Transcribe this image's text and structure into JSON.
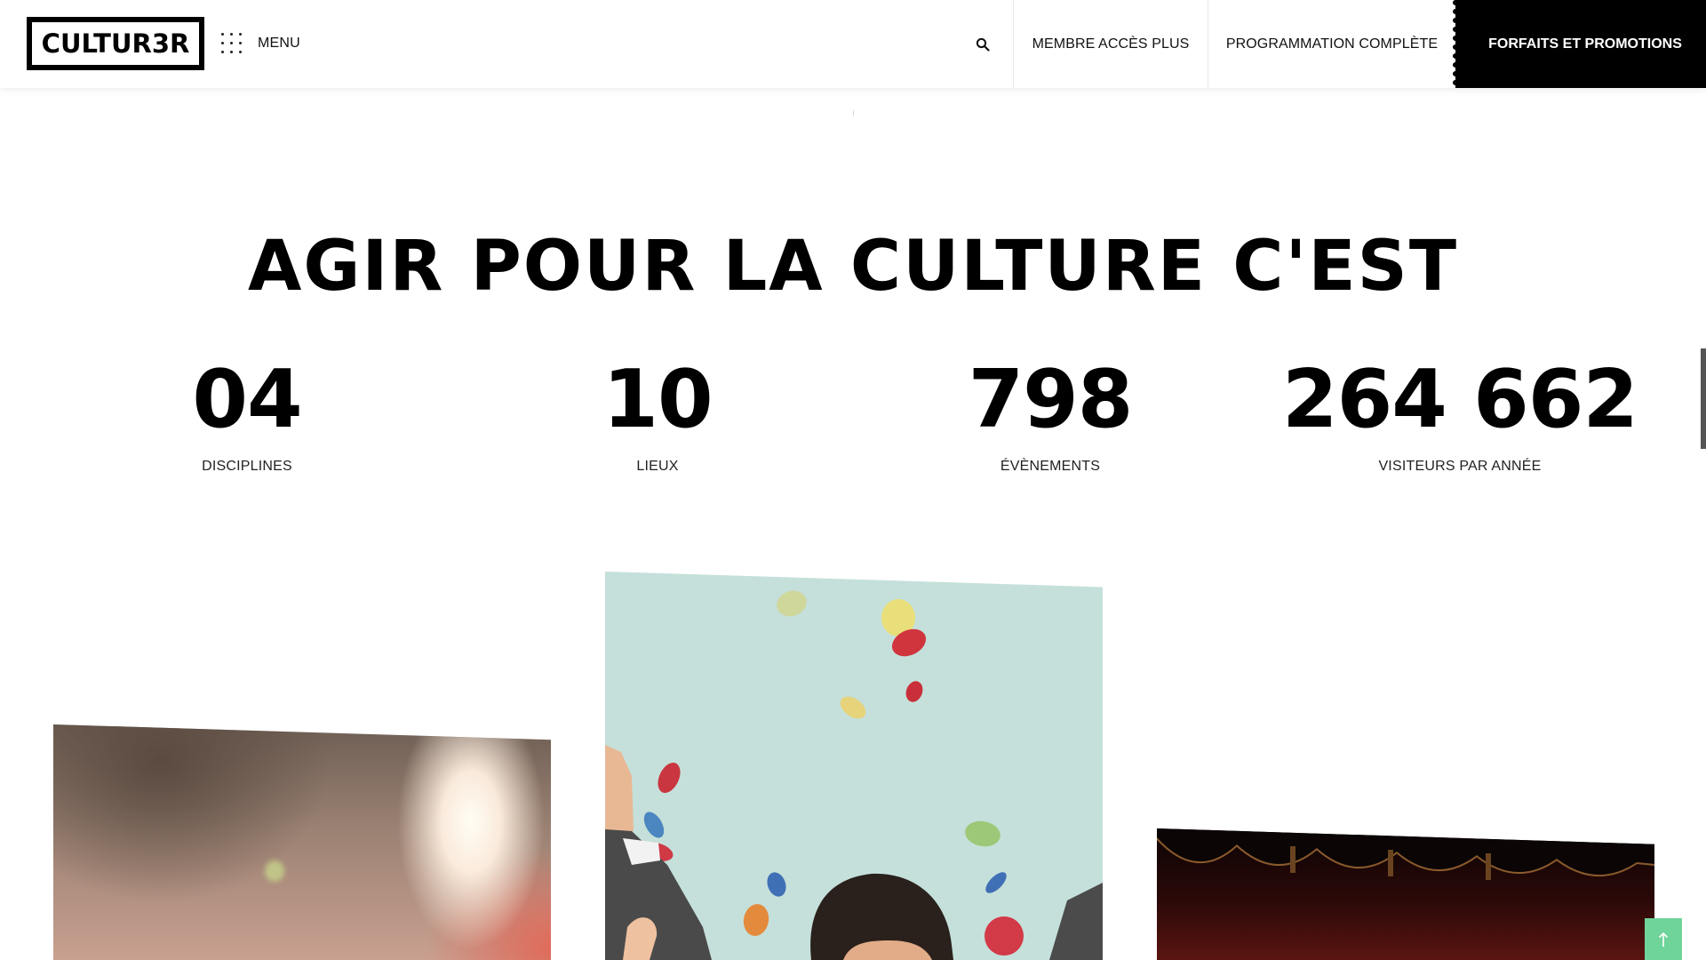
{
  "header": {
    "logo_text": "CULTUR3R",
    "menu_label": "MENU",
    "nav": {
      "membre": "MEMBRE ACCÈS PLUS",
      "programmation": "PROGRAMMATION COMPLÈTE",
      "forfaits": "FORFAITS ET PROMOTIONS"
    }
  },
  "main": {
    "headline": "AGIR POUR LA CULTURE C'EST",
    "stats": [
      {
        "value": "04",
        "label": "DISCIPLINES"
      },
      {
        "value": "10",
        "label": "LIEUX"
      },
      {
        "value": "798",
        "label": "ÉVÈNEMENTS"
      },
      {
        "value": "264 662",
        "label": "VISITEURS PAR ANNÉE"
      }
    ]
  },
  "icons": {
    "menu": "grid-dots-icon",
    "search": "search-icon",
    "back_to_top": "arrow-up-icon"
  },
  "colors": {
    "accent_black": "#000000",
    "back_to_top_green": "#6fd49a",
    "center_card_bg": "#c5e0da"
  }
}
